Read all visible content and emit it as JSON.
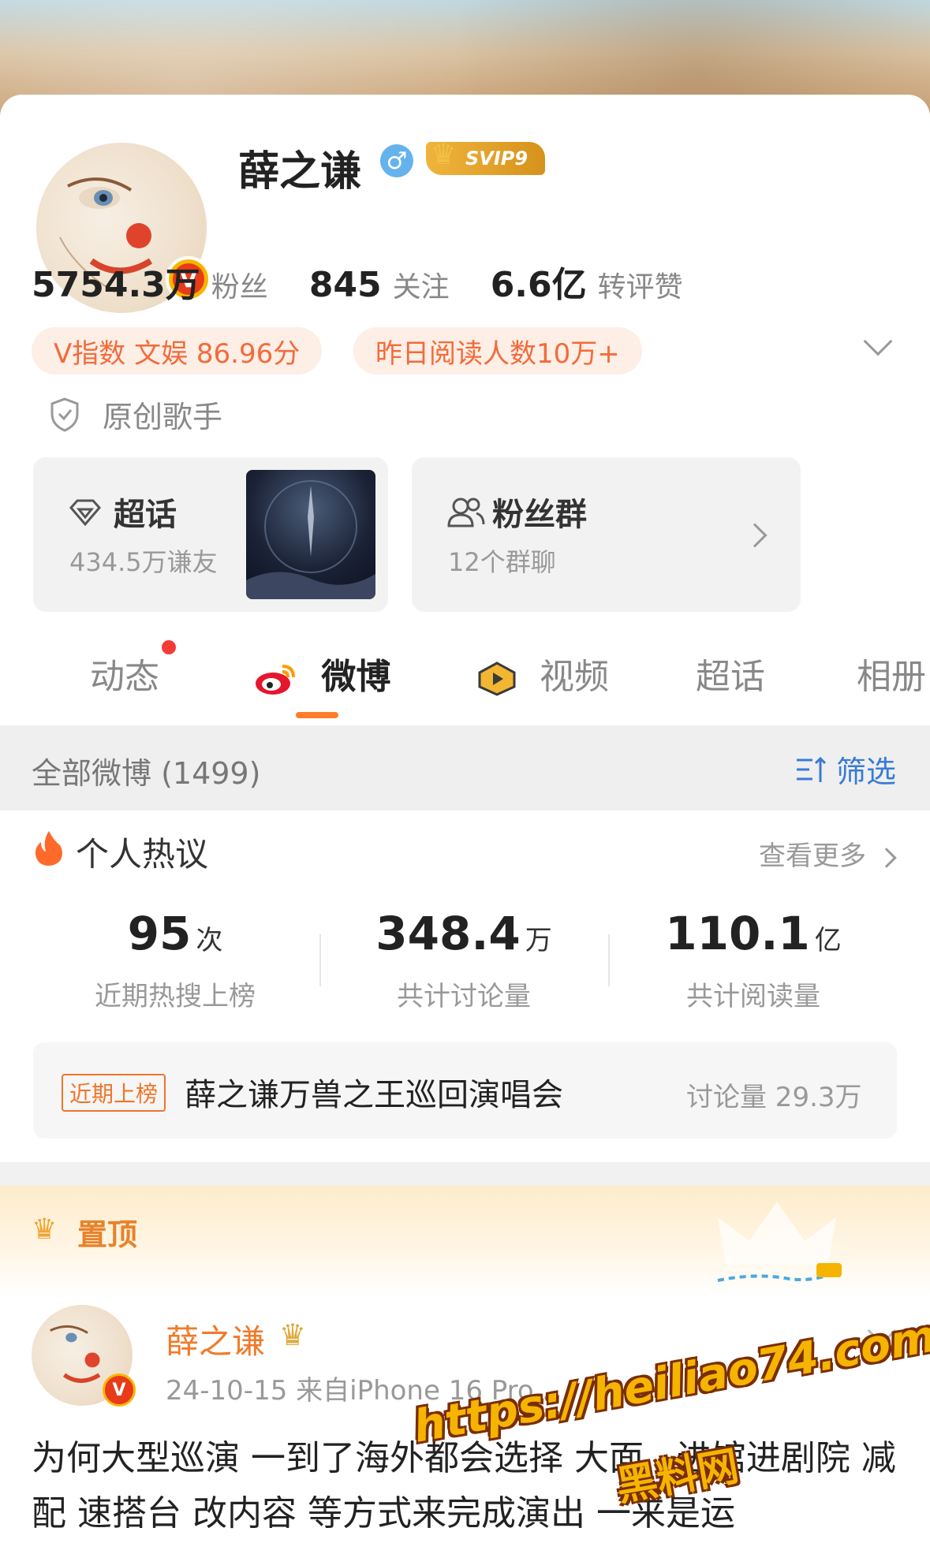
{
  "profile": {
    "name": "薛之谦",
    "gender_symbol": "♂",
    "vip_badge": "SVIP9",
    "verified_mark": "V"
  },
  "stats": [
    {
      "num": "5754.3万",
      "label": "粉丝"
    },
    {
      "num": "845",
      "label": "关注"
    },
    {
      "num": "6.6亿",
      "label": "转评赞"
    }
  ],
  "pills": {
    "vindex": "V指数 文娱 86.96分",
    "reads": "昨日阅读人数10万+"
  },
  "tag": "原创歌手",
  "chaohua_box": {
    "title": "超话",
    "sub": "434.5万谦友"
  },
  "fans_box": {
    "title": "粉丝群",
    "sub": "12个群聊"
  },
  "tabs": [
    "动态",
    "微博",
    "视频",
    "超话",
    "相册"
  ],
  "filter": {
    "title": "全部微博 (1499)",
    "button": "筛选"
  },
  "hot": {
    "title": "个人热议",
    "more": "查看更多",
    "metrics": [
      {
        "num": "95",
        "unit": "次",
        "label": "近期热搜上榜"
      },
      {
        "num": "348.4",
        "unit": "万",
        "label": "共计讨论量"
      },
      {
        "num": "110.1",
        "unit": "亿",
        "label": "共计阅读量"
      }
    ],
    "rank": {
      "tag": "近期上榜",
      "text": "薛之谦万兽之王巡回演唱会",
      "count": "讨论量 29.3万"
    }
  },
  "pinned_label": "置顶",
  "post": {
    "author": "薛之谦",
    "meta": "24-10-15  来自iPhone 16 Pro...",
    "text": "为何大型巡演 一到了海外都会选择 大面...进馆进剧院 减配 速搭台 改内容 等方式来完成演出 一来是运"
  },
  "watermark": {
    "url": "https://heiliao74.com",
    "site": "黑料网"
  },
  "colors": {
    "accent": "#ff7d2a",
    "link": "#3a7bd5",
    "verified": "#e73b1a"
  }
}
